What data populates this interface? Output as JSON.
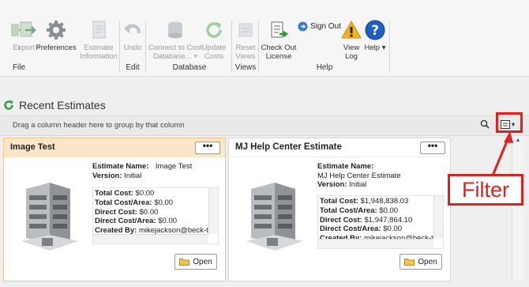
{
  "ribbon": {
    "groups": {
      "file": "File",
      "edit": "Edit",
      "database": "Database",
      "views": "Views",
      "help": "Help"
    },
    "buttons": {
      "export": "Export",
      "preferences": "Preferences",
      "estimate_information": "Estimate Information",
      "undo": "Undo",
      "connect": "Connect to Cost Database...",
      "update_costs": "Update Costs",
      "reset_views": "Reset Views",
      "check_out": "Check Out License",
      "view_log": "View Log",
      "help": "Help",
      "sign_out": "Sign Out"
    }
  },
  "section": {
    "title": "Recent Estimates",
    "drag_hint": "Drag a column header here to group by that column"
  },
  "cards": [
    {
      "title": "Image Test",
      "estimate_name_label": "Estimate Name:",
      "estimate_name": "Image Test",
      "version_label": "Version:",
      "version": "Initial",
      "rows": [
        {
          "label": "Total Cost:",
          "value": "$0.00"
        },
        {
          "label": "Total Cost/Area:",
          "value": "$0.00"
        },
        {
          "label": "Direct Cost:",
          "value": "$0.00"
        },
        {
          "label": "Direct Cost/Area:",
          "value": "$0.00"
        },
        {
          "label": "Created By:",
          "value": "mikejackson@beck-t"
        }
      ],
      "open_label": "Open"
    },
    {
      "title": "MJ Help Center Estimate",
      "estimate_name_label": "Estimate Name:",
      "estimate_name": "MJ Help Center Estimate",
      "version_label": "Version:",
      "version": "Initial",
      "rows": [
        {
          "label": "Total Cost:",
          "value": "$1,948,838.03"
        },
        {
          "label": "Total Cost/Area:",
          "value": "$0.00"
        },
        {
          "label": "Direct Cost:",
          "value": "$1,947,864.10"
        },
        {
          "label": "Direct Cost/Area:",
          "value": "$0.00"
        },
        {
          "label": "Created By:",
          "value": "mikejackson@beck-t"
        }
      ],
      "open_label": "Open"
    }
  ],
  "annotation": {
    "callout": "Filter"
  },
  "colors": {
    "accent_red": "#e0201f",
    "selected_card": "#fde6c8",
    "help_blue": "#1f5fbf"
  }
}
